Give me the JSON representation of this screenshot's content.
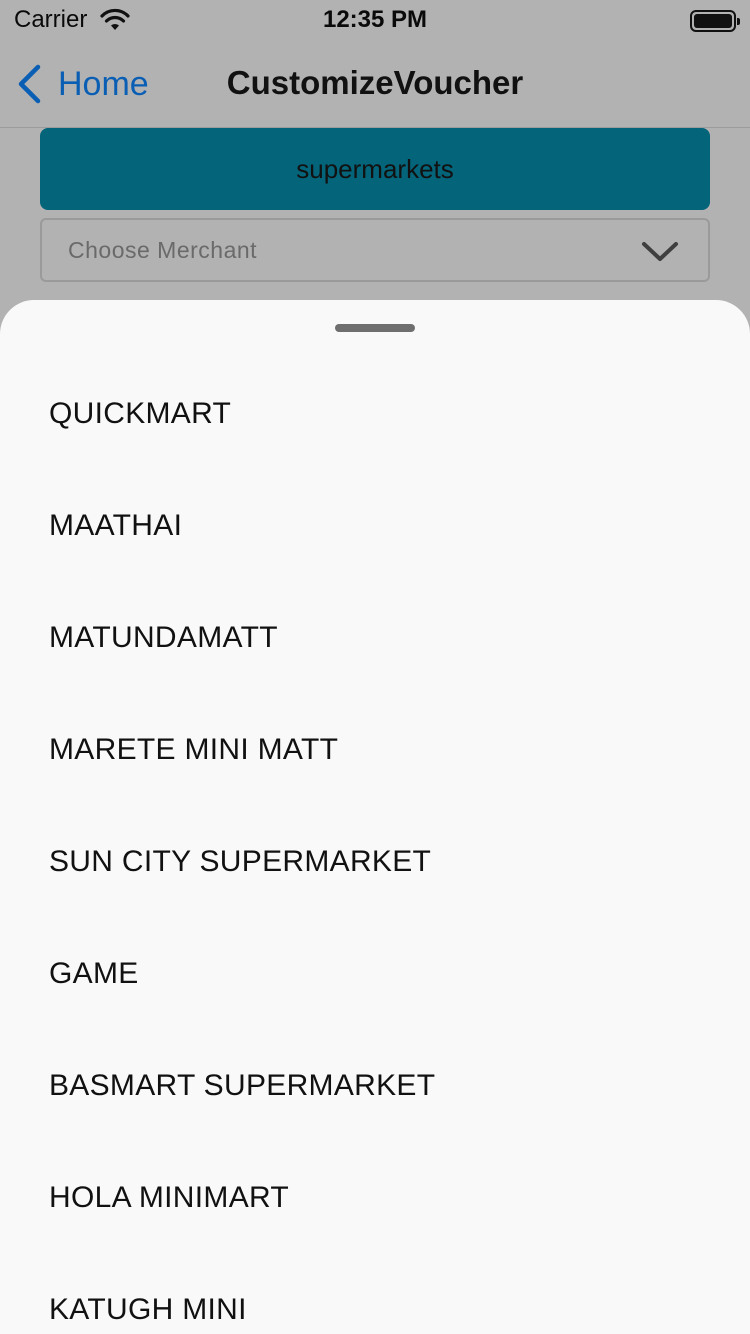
{
  "status_bar": {
    "carrier": "Carrier",
    "time": "12:35 PM",
    "icons": [
      "wifi-icon",
      "battery-icon"
    ]
  },
  "nav": {
    "back_label": "Home",
    "title": "CustomizeVoucher"
  },
  "form": {
    "category_label": "supermarkets",
    "merchant_placeholder": "Choose Merchant"
  },
  "sheet": {
    "options": [
      "QUICKMART",
      "MAATHAI",
      "MATUNDAMATT",
      "MARETE MINI MATT",
      "SUN CITY SUPERMARKET",
      "GAME",
      "BASMART SUPERMARKET",
      "HOLA MINIMART",
      "KATUGH MINI"
    ]
  },
  "colors": {
    "accent": "#0a5fb4",
    "category_button": "#04647a",
    "dim_background": "#b2b2b2",
    "sheet_background": "#f9f9f9"
  }
}
